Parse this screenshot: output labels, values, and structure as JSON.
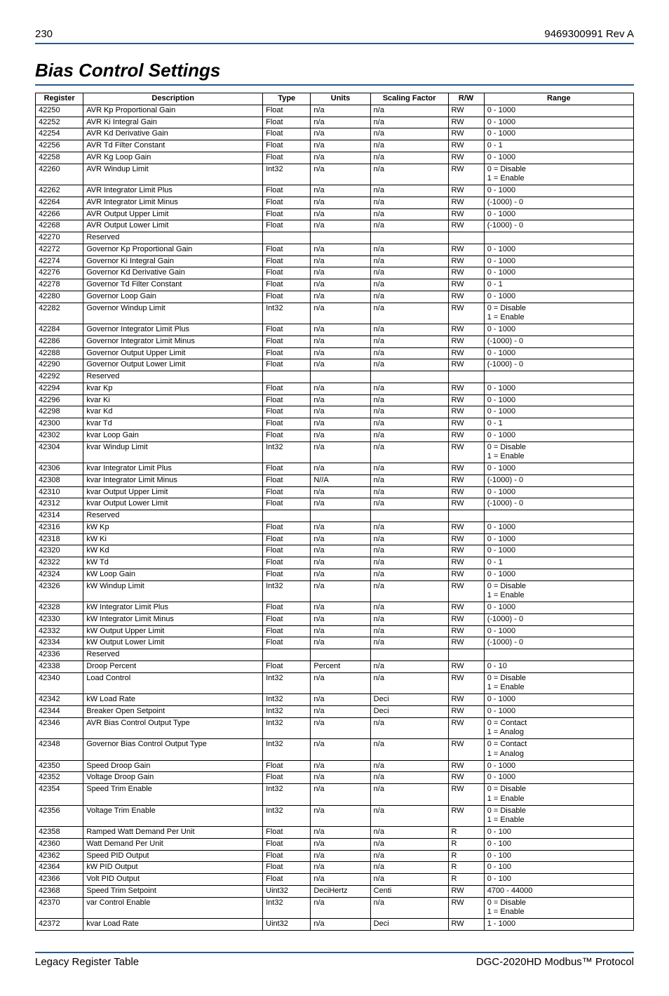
{
  "header": {
    "page_num": "230",
    "doc_id": "9469300991 Rev A"
  },
  "section_title": "Bias Control Settings",
  "columns": [
    "Register",
    "Description",
    "Type",
    "Units",
    "Scaling Factor",
    "R/W",
    "Range"
  ],
  "rows": [
    {
      "reg": "42250",
      "desc": "AVR Kp Proportional Gain",
      "type": "Float",
      "units": "n/a",
      "scale": "n/a",
      "rw": "RW",
      "range": "0 - 1000"
    },
    {
      "reg": "42252",
      "desc": "AVR Ki  Integral Gain",
      "type": "Float",
      "units": "n/a",
      "scale": "n/a",
      "rw": "RW",
      "range": "0 - 1000"
    },
    {
      "reg": "42254",
      "desc": "AVR Kd Derivative Gain",
      "type": "Float",
      "units": "n/a",
      "scale": "n/a",
      "rw": "RW",
      "range": "0 - 1000"
    },
    {
      "reg": "42256",
      "desc": "AVR Td Filter Constant",
      "type": "Float",
      "units": "n/a",
      "scale": "n/a",
      "rw": "RW",
      "range": "0 - 1"
    },
    {
      "reg": "42258",
      "desc": "AVR Kg Loop Gain",
      "type": "Float",
      "units": "n/a",
      "scale": "n/a",
      "rw": "RW",
      "range": "0 - 1000"
    },
    {
      "reg": "42260",
      "desc": "AVR Windup Limit",
      "type": "Int32",
      "units": "n/a",
      "scale": "n/a",
      "rw": "RW",
      "range": "0 = Disable\n1 = Enable"
    },
    {
      "reg": "42262",
      "desc": "AVR Integrator Limit Plus",
      "type": "Float",
      "units": "n/a",
      "scale": "n/a",
      "rw": "RW",
      "range": "0 - 1000"
    },
    {
      "reg": "42264",
      "desc": "AVR Integrator Limit Minus",
      "type": "Float",
      "units": "n/a",
      "scale": "n/a",
      "rw": "RW",
      "range": "(-1000) - 0"
    },
    {
      "reg": "42266",
      "desc": "AVR Output Upper Limit",
      "type": "Float",
      "units": "n/a",
      "scale": "n/a",
      "rw": "RW",
      "range": "0 - 1000"
    },
    {
      "reg": "42268",
      "desc": "AVR Output Lower Limit",
      "type": "Float",
      "units": "n/a",
      "scale": "n/a",
      "rw": "RW",
      "range": "(-1000) - 0"
    },
    {
      "reg": "42270",
      "desc": "Reserved",
      "type": "",
      "units": "",
      "scale": "",
      "rw": "",
      "range": ""
    },
    {
      "reg": "42272",
      "desc": "Governor Kp Proportional Gain",
      "type": "Float",
      "units": "n/a",
      "scale": "n/a",
      "rw": "RW",
      "range": "0 - 1000"
    },
    {
      "reg": "42274",
      "desc": "Governor Ki Integral Gain",
      "type": "Float",
      "units": "n/a",
      "scale": "n/a",
      "rw": "RW",
      "range": "0 - 1000"
    },
    {
      "reg": "42276",
      "desc": "Governor Kd Derivative Gain",
      "type": "Float",
      "units": "n/a",
      "scale": "n/a",
      "rw": "RW",
      "range": "0 - 1000"
    },
    {
      "reg": "42278",
      "desc": "Governor Td Filter Constant",
      "type": "Float",
      "units": "n/a",
      "scale": "n/a",
      "rw": "RW",
      "range": "0 - 1"
    },
    {
      "reg": "42280",
      "desc": "Governor Loop Gain",
      "type": "Float",
      "units": "n/a",
      "scale": "n/a",
      "rw": "RW",
      "range": "0 - 1000"
    },
    {
      "reg": "42282",
      "desc": "Governor Windup Limit",
      "type": "Int32",
      "units": "n/a",
      "scale": "n/a",
      "rw": "RW",
      "range": "0 = Disable\n1 = Enable"
    },
    {
      "reg": "42284",
      "desc": "Governor Integrator Limit Plus",
      "type": "Float",
      "units": "n/a",
      "scale": "n/a",
      "rw": "RW",
      "range": "0 - 1000"
    },
    {
      "reg": "42286",
      "desc": "Governor Integrator Limit Minus",
      "type": "Float",
      "units": "n/a",
      "scale": "n/a",
      "rw": "RW",
      "range": "(-1000) - 0"
    },
    {
      "reg": "42288",
      "desc": "Governor Output Upper Limit",
      "type": "Float",
      "units": "n/a",
      "scale": "n/a",
      "rw": "RW",
      "range": "0 - 1000"
    },
    {
      "reg": "42290",
      "desc": "Governor Output Lower Limit",
      "type": "Float",
      "units": "n/a",
      "scale": "n/a",
      "rw": "RW",
      "range": "(-1000) - 0"
    },
    {
      "reg": "42292",
      "desc": "Reserved",
      "type": "",
      "units": "",
      "scale": "",
      "rw": "",
      "range": ""
    },
    {
      "reg": "42294",
      "desc": "kvar Kp",
      "type": "Float",
      "units": "n/a",
      "scale": "n/a",
      "rw": "RW",
      "range": "0 - 1000"
    },
    {
      "reg": "42296",
      "desc": "kvar Ki",
      "type": "Float",
      "units": "n/a",
      "scale": "n/a",
      "rw": "RW",
      "range": "0 - 1000"
    },
    {
      "reg": "42298",
      "desc": "kvar Kd",
      "type": "Float",
      "units": "n/a",
      "scale": "n/a",
      "rw": "RW",
      "range": "0 - 1000"
    },
    {
      "reg": "42300",
      "desc": "kvar Td",
      "type": "Float",
      "units": "n/a",
      "scale": "n/a",
      "rw": "RW",
      "range": "0 - 1"
    },
    {
      "reg": "42302",
      "desc": "kvar Loop Gain",
      "type": "Float",
      "units": "n/a",
      "scale": "n/a",
      "rw": "RW",
      "range": "0 - 1000"
    },
    {
      "reg": "42304",
      "desc": "kvar Windup Limit",
      "type": "Int32",
      "units": "n/a",
      "scale": "n/a",
      "rw": "RW",
      "range": "0 = Disable\n1 = Enable"
    },
    {
      "reg": "42306",
      "desc": "kvar Integrator Limit Plus",
      "type": "Float",
      "units": "n/a",
      "scale": "n/a",
      "rw": "RW",
      "range": "0 - 1000"
    },
    {
      "reg": "42308",
      "desc": "kvar Integrator Limit Minus",
      "type": "Float",
      "units": "N//A",
      "scale": "n/a",
      "rw": "RW",
      "range": "(-1000) - 0"
    },
    {
      "reg": "42310",
      "desc": "kvar Output Upper Limit",
      "type": "Float",
      "units": "n/a",
      "scale": "n/a",
      "rw": "RW",
      "range": "0 - 1000"
    },
    {
      "reg": "42312",
      "desc": "kvar Output Lower Limit",
      "type": "Float",
      "units": "n/a",
      "scale": "n/a",
      "rw": "RW",
      "range": "(-1000) - 0"
    },
    {
      "reg": "42314",
      "desc": "Reserved",
      "type": "",
      "units": "",
      "scale": "",
      "rw": "",
      "range": ""
    },
    {
      "reg": "42316",
      "desc": "kW Kp",
      "type": "Float",
      "units": "n/a",
      "scale": "n/a",
      "rw": "RW",
      "range": "0 - 1000"
    },
    {
      "reg": "42318",
      "desc": "kW Ki",
      "type": "Float",
      "units": "n/a",
      "scale": "n/a",
      "rw": "RW",
      "range": "0 - 1000"
    },
    {
      "reg": "42320",
      "desc": "kW Kd",
      "type": "Float",
      "units": "n/a",
      "scale": "n/a",
      "rw": "RW",
      "range": "0 - 1000"
    },
    {
      "reg": "42322",
      "desc": "kW Td",
      "type": "Float",
      "units": "n/a",
      "scale": "n/a",
      "rw": "RW",
      "range": "0 - 1"
    },
    {
      "reg": "42324",
      "desc": "kW Loop Gain",
      "type": "Float",
      "units": "n/a",
      "scale": "n/a",
      "rw": "RW",
      "range": "0 - 1000"
    },
    {
      "reg": "42326",
      "desc": "kW Windup Limit",
      "type": "Int32",
      "units": "n/a",
      "scale": "n/a",
      "rw": "RW",
      "range": "0 = Disable\n1 = Enable"
    },
    {
      "reg": "42328",
      "desc": "kW Integrator Limit Plus",
      "type": "Float",
      "units": "n/a",
      "scale": "n/a",
      "rw": "RW",
      "range": "0 - 1000"
    },
    {
      "reg": "42330",
      "desc": "kW Integrator Limit Minus",
      "type": "Float",
      "units": "n/a",
      "scale": "n/a",
      "rw": "RW",
      "range": "(-1000) - 0"
    },
    {
      "reg": "42332",
      "desc": "kW Output Upper Limit",
      "type": "Float",
      "units": "n/a",
      "scale": "n/a",
      "rw": "RW",
      "range": "0 - 1000"
    },
    {
      "reg": "42334",
      "desc": "kW Output Lower Limit",
      "type": "Float",
      "units": "n/a",
      "scale": "n/a",
      "rw": "RW",
      "range": "(-1000) - 0"
    },
    {
      "reg": "42336",
      "desc": "Reserved",
      "type": "",
      "units": "",
      "scale": "",
      "rw": "",
      "range": ""
    },
    {
      "reg": "42338",
      "desc": "Droop Percent",
      "type": "Float",
      "units": "Percent",
      "scale": "n/a",
      "rw": "RW",
      "range": "0 - 10"
    },
    {
      "reg": "42340",
      "desc": "Load Control",
      "type": "Int32",
      "units": "n/a",
      "scale": "n/a",
      "rw": "RW",
      "range": "0 = Disable\n1 = Enable"
    },
    {
      "reg": "42342",
      "desc": "kW Load Rate",
      "type": "Int32",
      "units": "n/a",
      "scale": "Deci",
      "rw": "RW",
      "range": "0 - 1000"
    },
    {
      "reg": "42344",
      "desc": "Breaker Open Setpoint",
      "type": "Int32",
      "units": "n/a",
      "scale": "Deci",
      "rw": "RW",
      "range": "0 - 1000"
    },
    {
      "reg": "42346",
      "desc": "AVR Bias Control Output Type",
      "type": "Int32",
      "units": "n/a",
      "scale": "n/a",
      "rw": "RW",
      "range": "0 = Contact\n1 = Analog"
    },
    {
      "reg": "42348",
      "desc": "Governor Bias Control Output Type",
      "type": "Int32",
      "units": "n/a",
      "scale": "n/a",
      "rw": "RW",
      "range": "0 = Contact\n1 = Analog"
    },
    {
      "reg": "42350",
      "desc": "Speed Droop Gain",
      "type": "Float",
      "units": "n/a",
      "scale": "n/a",
      "rw": "RW",
      "range": "0 - 1000"
    },
    {
      "reg": "42352",
      "desc": "Voltage Droop Gain",
      "type": "Float",
      "units": "n/a",
      "scale": "n/a",
      "rw": "RW",
      "range": "0 - 1000"
    },
    {
      "reg": "42354",
      "desc": "Speed Trim Enable",
      "type": "Int32",
      "units": "n/a",
      "scale": "n/a",
      "rw": "RW",
      "range": "0 = Disable\n1 = Enable"
    },
    {
      "reg": "42356",
      "desc": "Voltage Trim Enable",
      "type": "Int32",
      "units": "n/a",
      "scale": "n/a",
      "rw": "RW",
      "range": "0 = Disable\n1 = Enable"
    },
    {
      "reg": "42358",
      "desc": "Ramped Watt Demand Per Unit",
      "type": "Float",
      "units": "n/a",
      "scale": "n/a",
      "rw": "R",
      "range": "0 - 100"
    },
    {
      "reg": "42360",
      "desc": "Watt Demand Per Unit",
      "type": "Float",
      "units": "n/a",
      "scale": "n/a",
      "rw": "R",
      "range": "0 - 100"
    },
    {
      "reg": "42362",
      "desc": "Speed PID Output",
      "type": "Float",
      "units": "n/a",
      "scale": "n/a",
      "rw": "R",
      "range": "0 - 100"
    },
    {
      "reg": "42364",
      "desc": "kW PID Output",
      "type": "Float",
      "units": "n/a",
      "scale": "n/a",
      "rw": "R",
      "range": "0 - 100"
    },
    {
      "reg": "42366",
      "desc": "Volt PID Output",
      "type": "Float",
      "units": "n/a",
      "scale": "n/a",
      "rw": "R",
      "range": "0 - 100"
    },
    {
      "reg": "42368",
      "desc": "Speed Trim Setpoint",
      "type": "Uint32",
      "units": "DeciHertz",
      "scale": "Centi",
      "rw": "RW",
      "range": "4700 - 44000"
    },
    {
      "reg": "42370",
      "desc": "var Control Enable",
      "type": "Int32",
      "units": "n/a",
      "scale": "n/a",
      "rw": "RW",
      "range": "0 = Disable\n1 = Enable"
    },
    {
      "reg": "42372",
      "desc": "kvar Load Rate",
      "type": "Uint32",
      "units": "n/a",
      "scale": "Deci",
      "rw": "RW",
      "range": "1 - 1000"
    }
  ],
  "footer": {
    "left": "Legacy Register Table",
    "right": "DGC-2020HD Modbus™ Protocol"
  }
}
